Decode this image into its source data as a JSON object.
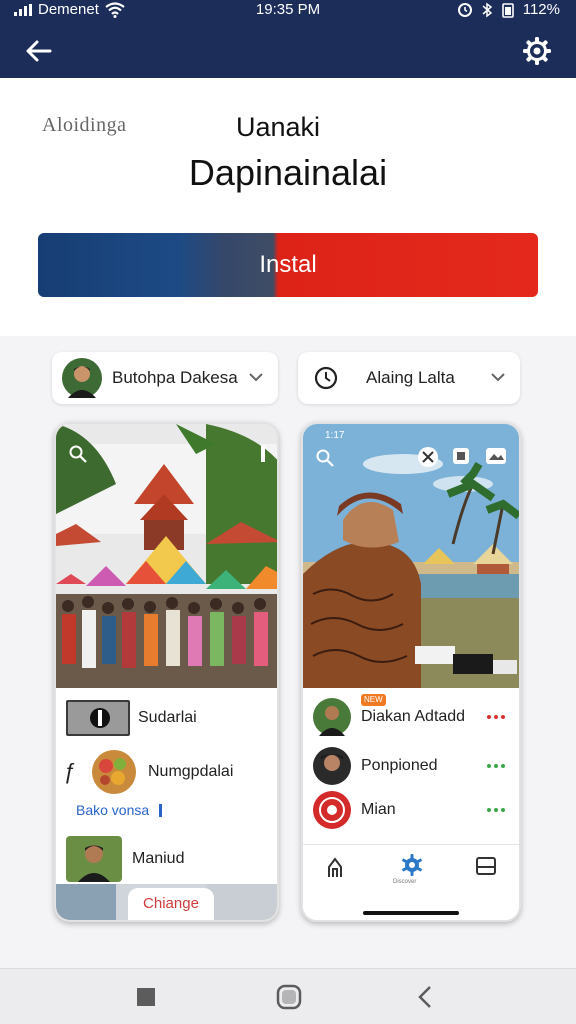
{
  "status_bar": {
    "carrier": "Demenet",
    "time": "19:35 PM",
    "battery": "112%"
  },
  "app_bar": {
    "back_icon": "arrow-left-icon",
    "settings_icon": "gear-icon",
    "color": "#1c2d5a"
  },
  "hero": {
    "brand": "Aloidinga",
    "subtitle": "Uanaki",
    "title": "Dapinainalai",
    "install_label": "Instal"
  },
  "left_selector": {
    "label": "Butohpa Dakesa"
  },
  "right_selector": {
    "label": "Alaing Lalta"
  },
  "left_phone": {
    "items": [
      {
        "label": "Sudarlai"
      },
      {
        "label": "Numgpdalai"
      }
    ],
    "link": "Bako vonsa",
    "third_item": "Maniud",
    "button": "Chiange"
  },
  "right_phone": {
    "time": "1:17",
    "contacts": [
      {
        "label": "Diakan Adtadd",
        "badge": "NEW",
        "dot_color": "#d93030"
      },
      {
        "label": "Ponpioned",
        "dot_color": "#3aa84a"
      },
      {
        "label": "Mian",
        "dot_color": "#3aa84a"
      }
    ],
    "tabs": [
      {
        "icon": "home-icon"
      },
      {
        "icon": "settings-icon",
        "label": "Discover"
      },
      {
        "icon": "window-icon"
      }
    ]
  },
  "nav_bar": {
    "recent_icon": "square-icon",
    "home_icon": "home-circle-icon",
    "back_icon": "back-chevron-icon"
  }
}
